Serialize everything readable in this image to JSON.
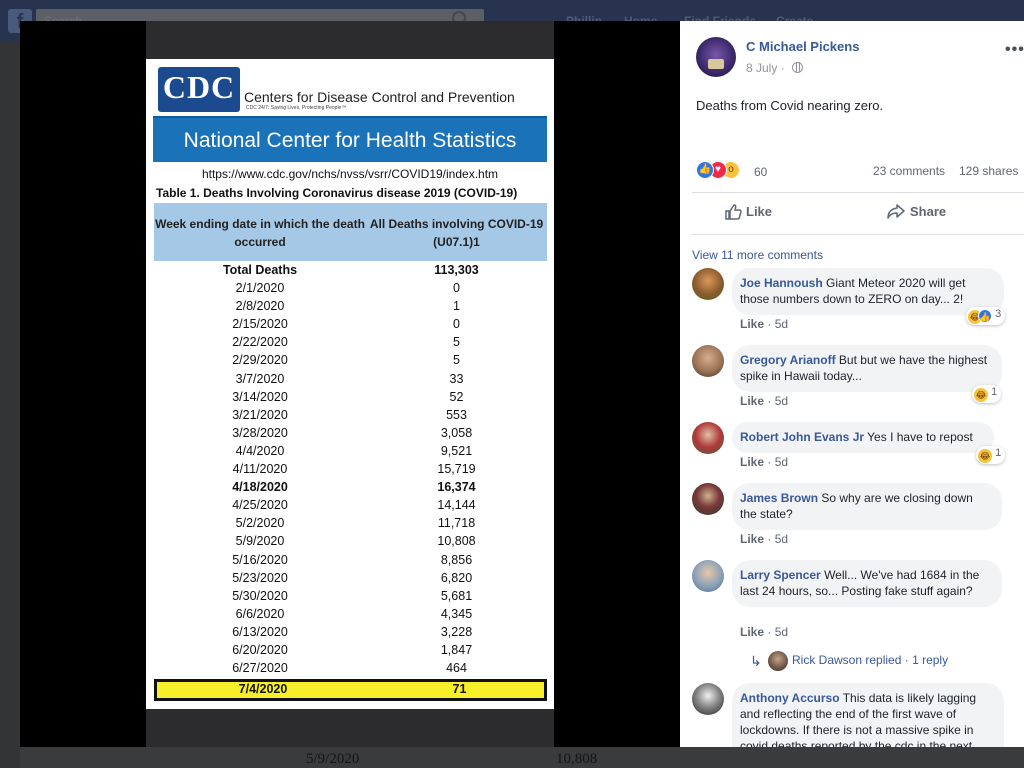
{
  "background": {
    "search_placeholder": "Search",
    "nav": [
      "Phillip",
      "Home",
      "Find Friends",
      "Create"
    ],
    "bottom_date": "5/9/2020",
    "bottom_value": "10,808"
  },
  "photo": {
    "cdc_logo": "CDC",
    "org_name": "Centers for Disease Control and Prevention",
    "tagline": "CDC 24/7: Saving Lives, Protecting People™",
    "nchs": "National Center for Health Statistics",
    "url": "https://www.cdc.gov/nchs/nvss/vsrr/COVID19/index.htm",
    "table_title": "Table 1. Deaths Involving Coronavirus disease 2019 (COVID-19)",
    "col1": "Week ending date in which the death occurred",
    "col2": "All Deaths involving COVID-19 (U07.1)1",
    "rows": [
      {
        "date": "Total Deaths",
        "value": "113,303",
        "style": "bold"
      },
      {
        "date": "2/1/2020",
        "value": "0"
      },
      {
        "date": "2/8/2020",
        "value": "1"
      },
      {
        "date": "2/15/2020",
        "value": "0"
      },
      {
        "date": "2/22/2020",
        "value": "5"
      },
      {
        "date": "2/29/2020",
        "value": "5"
      },
      {
        "date": "3/7/2020",
        "value": "33"
      },
      {
        "date": "3/14/2020",
        "value": "52"
      },
      {
        "date": "3/21/2020",
        "value": "553"
      },
      {
        "date": "3/28/2020",
        "value": "3,058"
      },
      {
        "date": "4/4/2020",
        "value": "9,521"
      },
      {
        "date": "4/11/2020",
        "value": "15,719"
      },
      {
        "date": "4/18/2020",
        "value": "16,374",
        "style": "bold"
      },
      {
        "date": "4/25/2020",
        "value": "14,144"
      },
      {
        "date": "5/2/2020",
        "value": "11,718"
      },
      {
        "date": "5/9/2020",
        "value": "10,808"
      },
      {
        "date": "5/16/2020",
        "value": "8,856"
      },
      {
        "date": "5/23/2020",
        "value": "6,820"
      },
      {
        "date": "5/30/2020",
        "value": "5,681"
      },
      {
        "date": "6/6/2020",
        "value": "4,345"
      },
      {
        "date": "6/13/2020",
        "value": "3,228"
      },
      {
        "date": "6/20/2020",
        "value": "1,847"
      },
      {
        "date": "6/27/2020",
        "value": "464"
      },
      {
        "date": "7/4/2020",
        "value": "71",
        "style": "highlight"
      }
    ]
  },
  "post": {
    "author": "C Michael Pickens",
    "date": "8 July",
    "separator": "·",
    "text": "Deaths from Covid nearing zero.",
    "reaction_count": "60",
    "comments": "23 comments",
    "shares": "129 shares",
    "like_label": "Like",
    "share_label": "Share",
    "more_icon": "•••",
    "view_more": "View 11 more comments"
  },
  "comments": [
    {
      "name": "Joe Hannoush",
      "text": "Giant Meteor 2020 will get those numbers down to ZERO on day... 2!",
      "like": "Like",
      "time": "5d",
      "reacts": [
        "haha",
        "like"
      ],
      "react_count": "3"
    },
    {
      "name": "Gregory Arianoff",
      "text": "But but we have the highest spike in Hawaii today...",
      "like": "Like",
      "time": "5d",
      "reacts": [
        "haha"
      ],
      "react_count": "1"
    },
    {
      "name": "Robert John Evans Jr",
      "text": "Yes I have to repost",
      "like": "Like",
      "time": "5d",
      "reacts": [
        "haha"
      ],
      "react_count": "1"
    },
    {
      "name": "James Brown",
      "text": "So why are we closing down the state?",
      "like": "Like",
      "time": "5d"
    },
    {
      "name": "Larry Spencer",
      "text": "Well... We've had 1684 in the last 24 hours, so... Posting fake stuff again?",
      "like": "Like",
      "time": "5d"
    },
    {
      "name": "Anthony Accurso",
      "text": "This data is likely lagging and reflecting the end of the first wave of lockdowns. If there is not a massive spike in covid deaths reported by the cdc in the next"
    }
  ],
  "reply": {
    "arrow": "↳",
    "name": "Rick Dawson",
    "replied": "replied · 1 reply"
  },
  "colors": {
    "link_blue": "#385898",
    "cdc_blue": "#1a73b8",
    "highlight_yellow": "#f7ef2a",
    "header_blue": "#a5c8e7"
  }
}
